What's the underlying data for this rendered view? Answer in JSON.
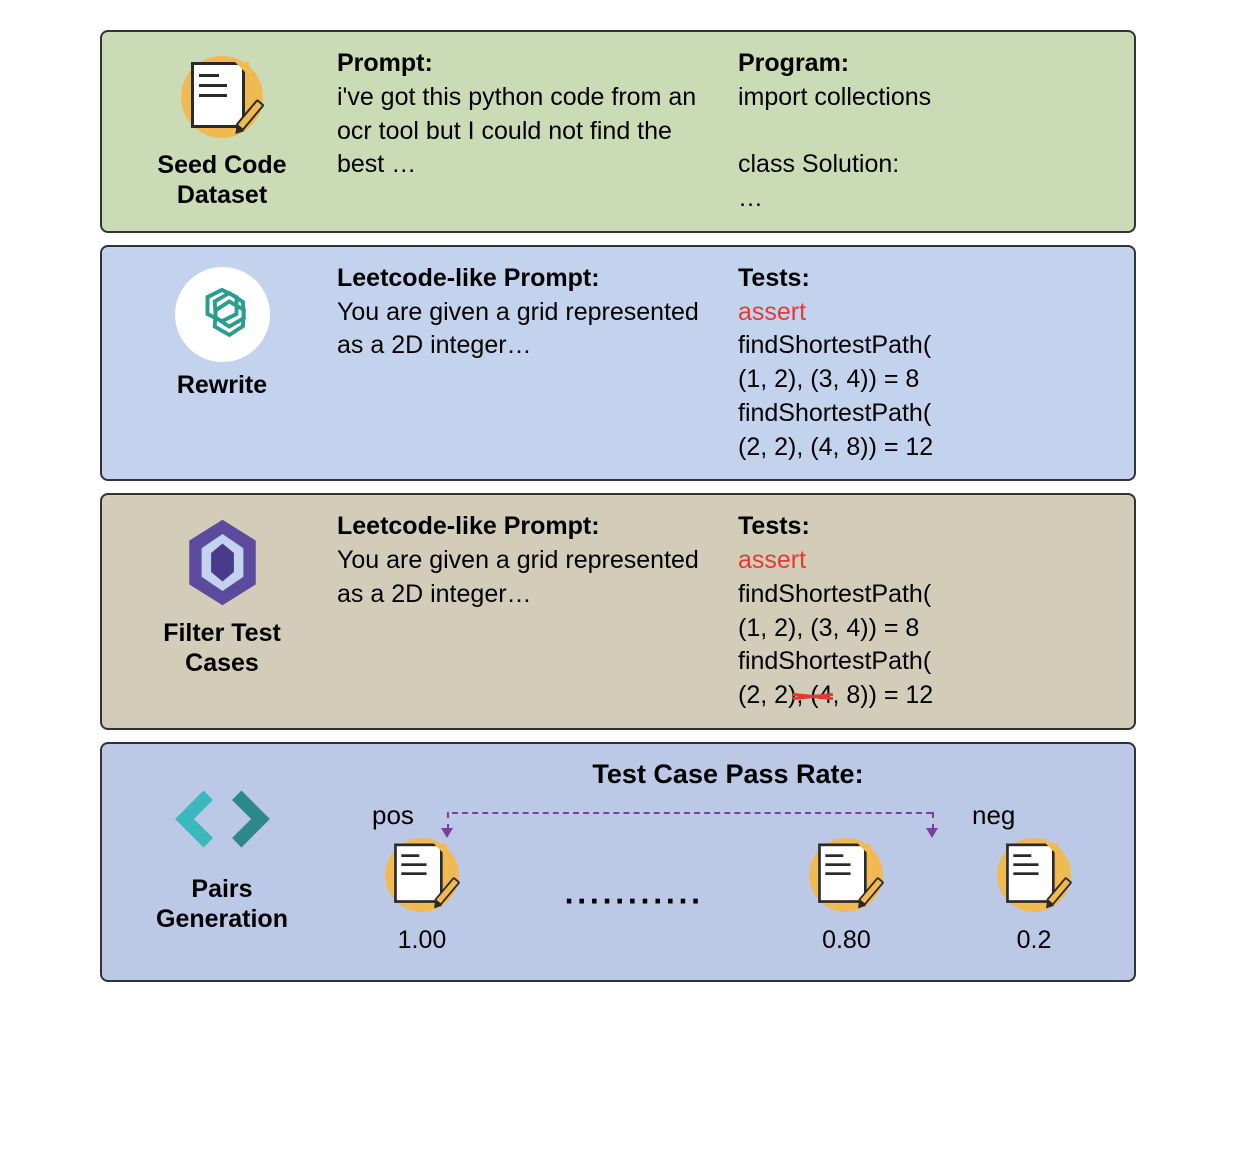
{
  "panels": {
    "seed": {
      "label": "Seed Code\nDataset",
      "prompt_label": "Prompt:",
      "prompt_text": "i've got this python code from an ocr tool but I could not find the best …",
      "program_label": "Program:",
      "program_text1": "import collections",
      "program_text2": "class Solution:",
      "program_text3": "…"
    },
    "rewrite": {
      "label": "Rewrite",
      "prompt_label": "Leetcode-like Prompt:",
      "prompt_text": "You are given a grid represented as a 2D integer…",
      "tests_label": "Tests:",
      "assert_kw": "assert",
      "test_line1": "findShortestPath(",
      "test_line2": "(1, 2), (3, 4)) = 8",
      "test_line3": "findShortestPath(",
      "test_line4": "(2, 2), (4, 8)) = 12"
    },
    "filter": {
      "label": "Filter Test\nCases",
      "prompt_label": "Leetcode-like Prompt:",
      "prompt_text": "You are given a grid represented as a 2D integer…",
      "tests_label": "Tests:",
      "assert_kw": "assert",
      "test_line1": "findShortestPath(",
      "test_line2": "(1, 2), (3, 4)) = 8",
      "test_line3": "findShortestPath(",
      "test_line4": "(2, 2), (4, 8)) = 12"
    },
    "pairs": {
      "label": "Pairs\nGeneration",
      "title": "Test Case Pass Rate:",
      "pos": "pos",
      "neg": "neg",
      "score1": "1.00",
      "score2": "0.80",
      "score3": "0.2"
    }
  }
}
